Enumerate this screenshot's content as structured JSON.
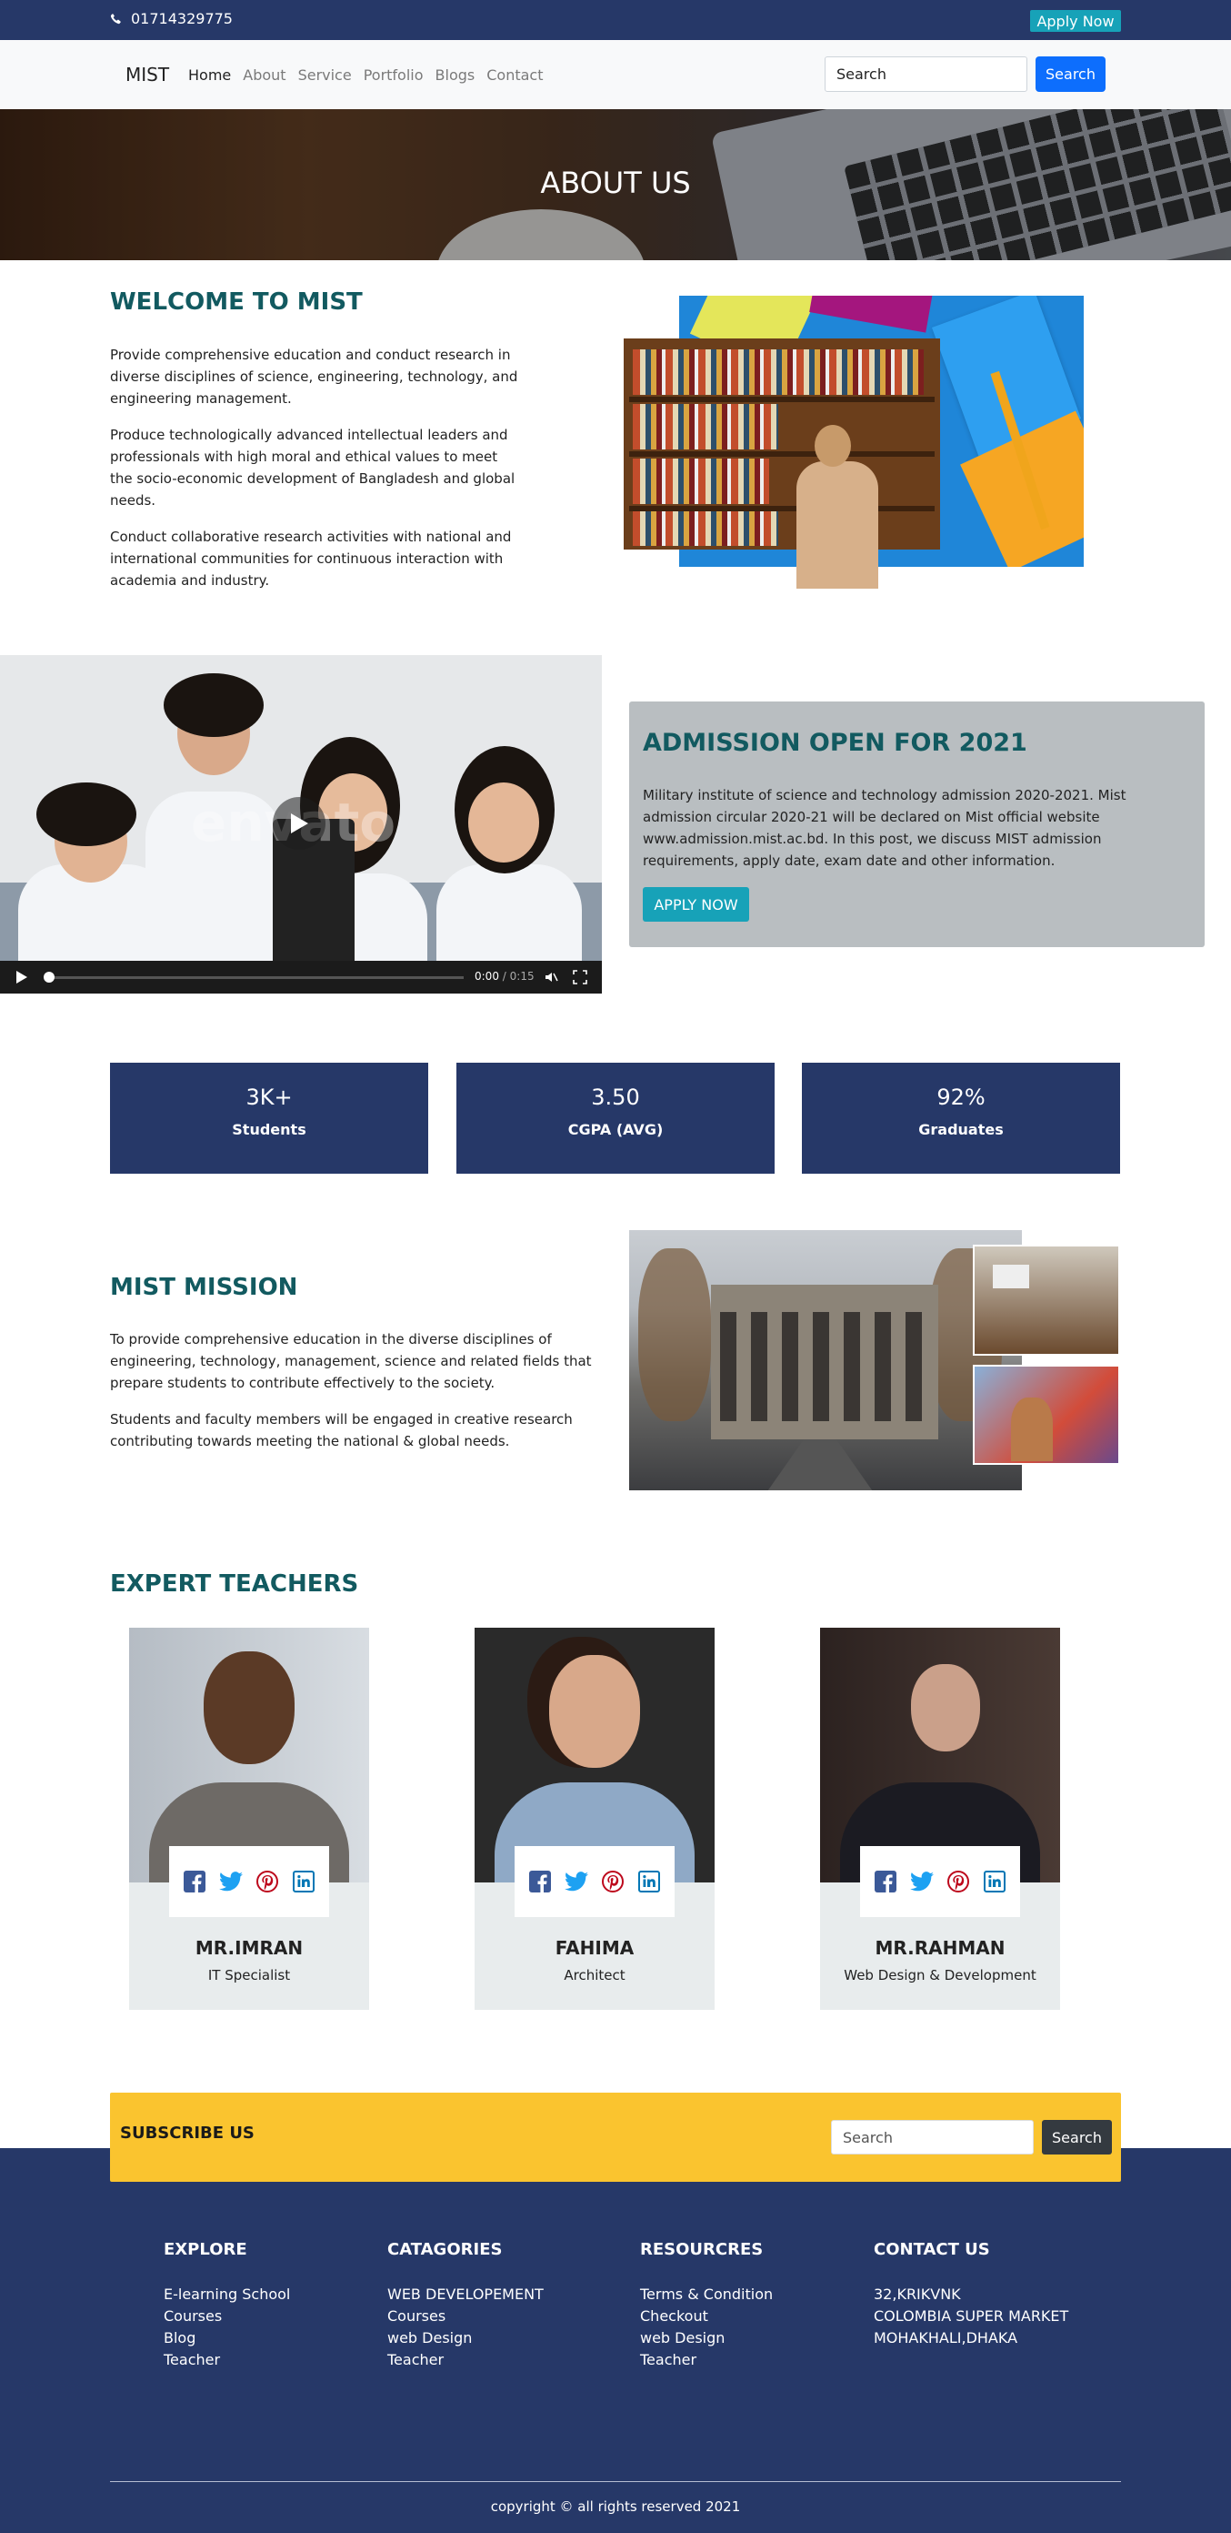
{
  "topbar": {
    "phone": "01714329775",
    "apply_label": "Apply Now"
  },
  "nav": {
    "brand": "MIST",
    "links": [
      {
        "label": "Home"
      },
      {
        "label": "About"
      },
      {
        "label": "Service"
      },
      {
        "label": "Portfolio"
      },
      {
        "label": "Blogs"
      },
      {
        "label": "Contact"
      }
    ],
    "search_placeholder": "Search",
    "search_label": "Search"
  },
  "hero": {
    "title": "ABOUT US"
  },
  "welcome": {
    "title": "WELCOME TO MIST",
    "paragraphs": [
      "Provide comprehensive education and conduct research in diverse disciplines of science, engineering, technology, and engineering management.",
      "Produce technologically advanced intellectual leaders and professionals with high moral and ethical values to meet the socio-economic development of Bangladesh and global needs.",
      "Conduct collaborative research activities with national and international communities for continuous interaction with academia and industry."
    ]
  },
  "video": {
    "watermark": "envato",
    "current_time": "0:00",
    "duration": "/ 0:15",
    "progress": 0
  },
  "admission": {
    "title": "ADMISSION OPEN FOR 2021",
    "text": "Military institute of science and technology admission 2020-2021. Mist admission circular 2020-21 will be declared on Mist official website www.admission.mist.ac.bd. In this post, we discuss MIST admission requirements, apply date, exam date and other information.",
    "button": "APPLY NOW"
  },
  "stats": [
    {
      "value": "3K+",
      "label": "Students"
    },
    {
      "value": "3.50",
      "label": "CGPA (AVG)"
    },
    {
      "value": "92%",
      "label": "Graduates"
    }
  ],
  "mission": {
    "title": "MIST MISSION",
    "paragraphs": [
      "To provide comprehensive education in the diverse disciplines of engineering, technology, management, science and related fields that prepare students to contribute effectively to the society.",
      "Students and faculty members will be engaged in creative research contributing towards meeting the national & global needs."
    ]
  },
  "teachers": {
    "title": "EXPERT TEACHERS",
    "items": [
      {
        "name": "MR.IMRAN",
        "role": "IT Specialist"
      },
      {
        "name": "FAHIMA",
        "role": "Architect"
      },
      {
        "name": "MR.RAHMAN",
        "role": "Web Design & Development"
      }
    ],
    "social_icons": [
      "facebook-icon",
      "twitter-icon",
      "pinterest-icon",
      "linkedin-icon"
    ]
  },
  "subscribe": {
    "title": "SUBSCRIBE US",
    "placeholder": "Search",
    "button": "Search"
  },
  "footer": {
    "columns": [
      {
        "title": "EXPLORE",
        "items": [
          "E-learning School",
          "Courses",
          "Blog",
          "Teacher"
        ]
      },
      {
        "title": "CATAGORIES",
        "items": [
          "WEB DEVELOPEMENT",
          "Courses",
          "web Design",
          "Teacher"
        ]
      },
      {
        "title": "RESOURCRES",
        "items": [
          "Terms & Condition",
          "Checkout",
          "web Design",
          "Teacher"
        ]
      },
      {
        "title": "CONTACT US",
        "items": [
          "32,KRIKVNK",
          "COLOMBIA SUPER MARKET",
          "MOHAKHALI,DHAKA"
        ]
      }
    ],
    "copyright": "copyright © all rights reserved 2021"
  },
  "colors": {
    "navy": "#263868",
    "teal_title": "#125a60",
    "accent_teal": "#17a2b8",
    "primary_blue": "#0d6efd",
    "subscribe_yellow": "#fac42f"
  }
}
